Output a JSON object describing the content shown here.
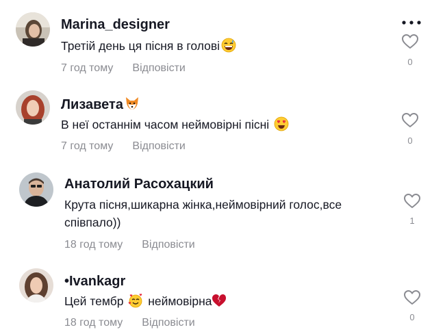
{
  "comments": [
    {
      "author": "Marina_designer",
      "text": "Третій день ця пісня в голові",
      "text_emoji_icon": "grinning-sweat-emoji",
      "time": "7 год тому",
      "reply_label": "Відповісти",
      "likes": "0"
    },
    {
      "author": "Лизавета",
      "author_emoji_icon": "fox-emoji",
      "text": "В неї останнім часом неймовірні пісні",
      "text_emoji_icon": "heart-eyes-emoji",
      "time": "7 год тому",
      "reply_label": "Відповісти",
      "likes": "0"
    },
    {
      "author": "Анатолий Расохацкий",
      "text_line1": "Крута пісня,шикарна жінка,неймовірний голос,все",
      "text_line2": "співпало))",
      "time": "18 год тому",
      "reply_label": "Відповісти",
      "likes": "1"
    },
    {
      "author": "•Ivankagr",
      "text_part1": "Цей тембр",
      "text_emoji_icon": "smiling-hearts-emoji",
      "text_part2": "неймовірна",
      "text_end_emoji_icon": "broken-heart-emoji",
      "time": "18 год тому",
      "reply_label": "Відповісти",
      "likes": "0"
    }
  ],
  "icons": {
    "like": "heart-outline-icon",
    "more": "more-dots-icon"
  },
  "colors": {
    "text": "#161823",
    "muted": "#8a8b91"
  }
}
